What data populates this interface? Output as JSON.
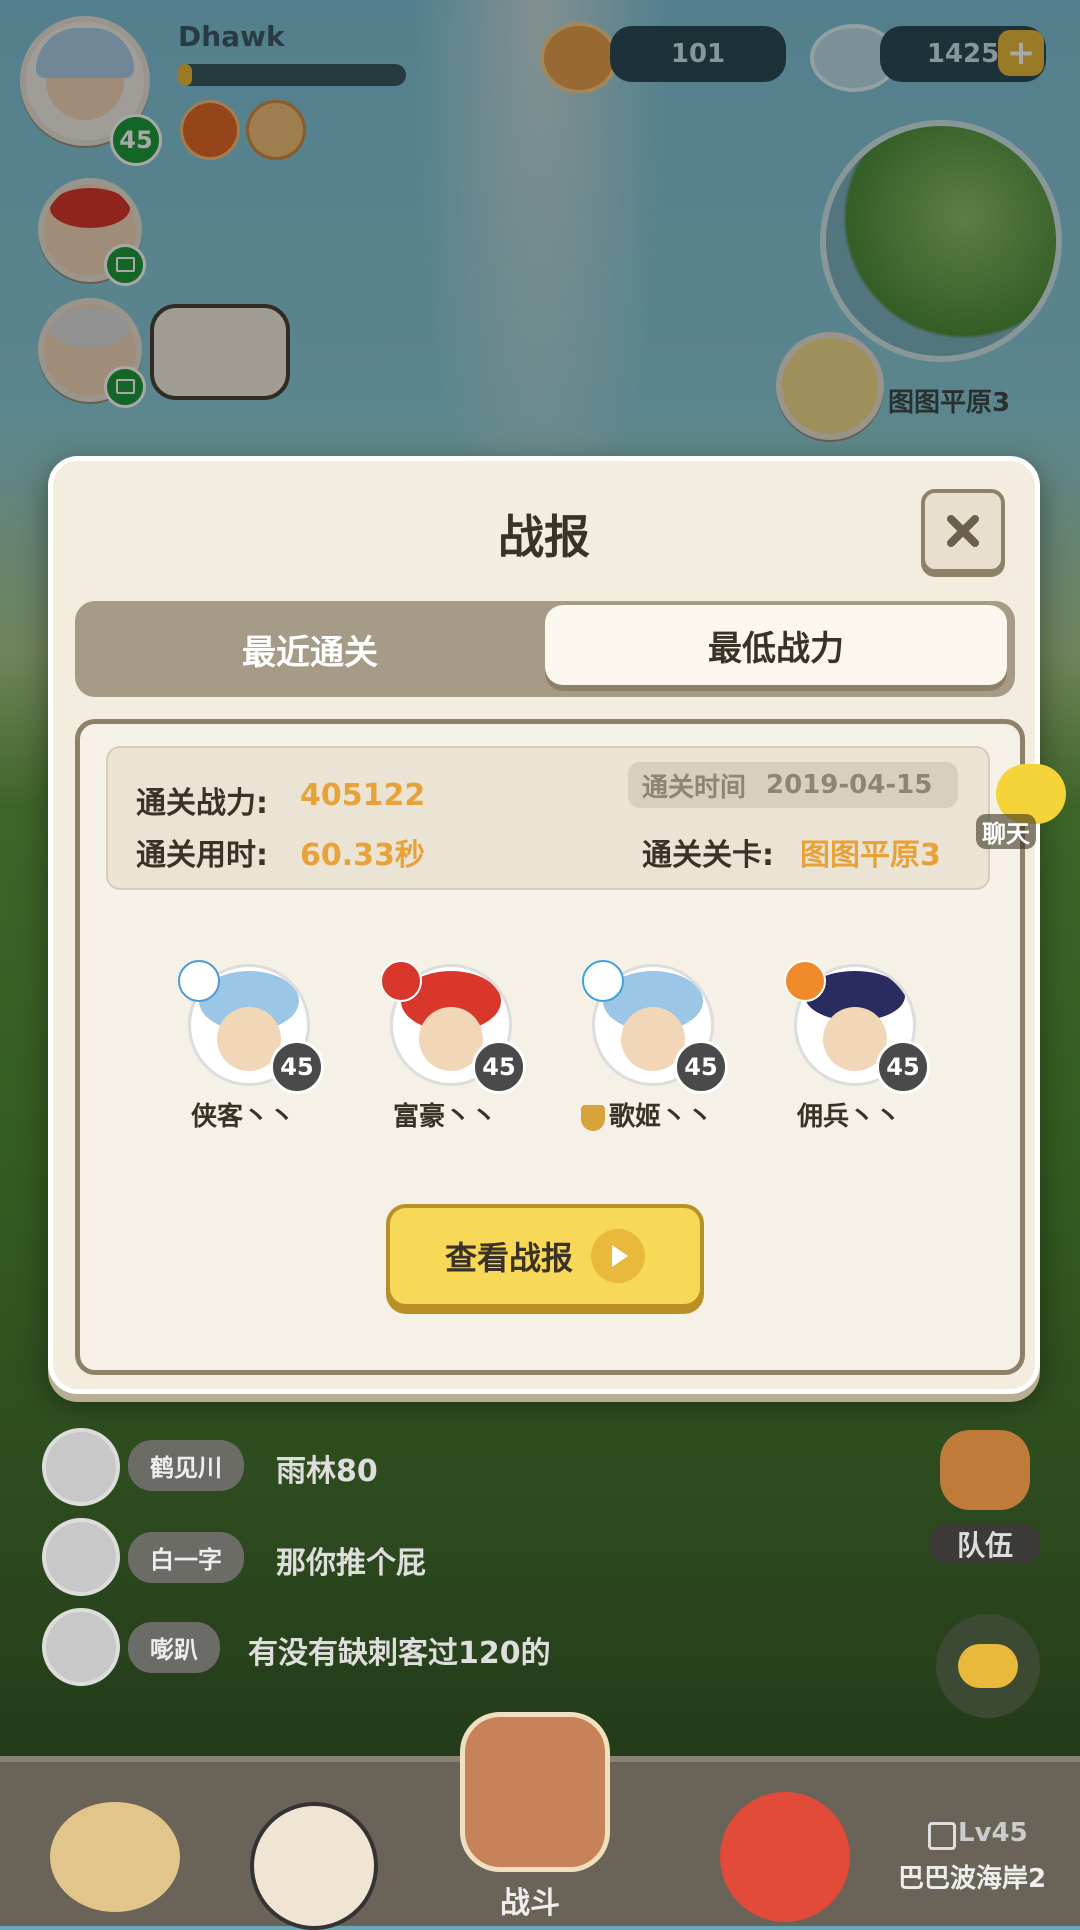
{
  "player": {
    "name": "Dhawk",
    "level": "45",
    "exp_fraction": 0.06
  },
  "currency": {
    "pearls": "101",
    "shells": "1425"
  },
  "map_label": "图图平原3",
  "modal": {
    "title": "战报",
    "tabs": [
      {
        "label": "最近通关",
        "active": false
      },
      {
        "label": "最低战力",
        "active": true
      }
    ],
    "summary": {
      "power_label": "通关战力:",
      "power_value": "405122",
      "time_used_label": "通关用时:",
      "time_used_value": "60.33秒",
      "clear_time_label": "通关时间",
      "clear_time_value": "2019-04-15",
      "stage_label": "通关关卡:",
      "stage_value": "图图平原3"
    },
    "heroes": [
      {
        "name": "侠客丶丶",
        "level": "45",
        "hair": "#9bc6e6",
        "element": "#4a9bd8"
      },
      {
        "name": "富豪丶丶",
        "level": "45",
        "hair": "#d9372b",
        "element": "#d9372b"
      },
      {
        "name": "歌姬丶丶",
        "level": "45",
        "hair": "#9bc6e6",
        "element": "#3aa3e0"
      },
      {
        "name": "佣兵丶丶",
        "level": "45",
        "hair": "#2a2b5e",
        "element": "#f08a2a"
      }
    ],
    "view_button": "查看战报"
  },
  "chat_float_label": "聊天",
  "chat": [
    {
      "name": "鹤见川",
      "text": "雨林80"
    },
    {
      "name": "白一字",
      "text": "那你推个屁"
    },
    {
      "name": "嘭趴",
      "text": "有没有缺刺客过120的"
    }
  ],
  "team_label": "队伍",
  "bottom_nav": {
    "battle_label": "战斗",
    "locked_level": "Lv45",
    "locked_name": "巴巴波海岸2"
  },
  "colors": {
    "accent": "#e8a23a",
    "level_green": "#1f9b3a",
    "button_yellow": "#f8d957"
  }
}
